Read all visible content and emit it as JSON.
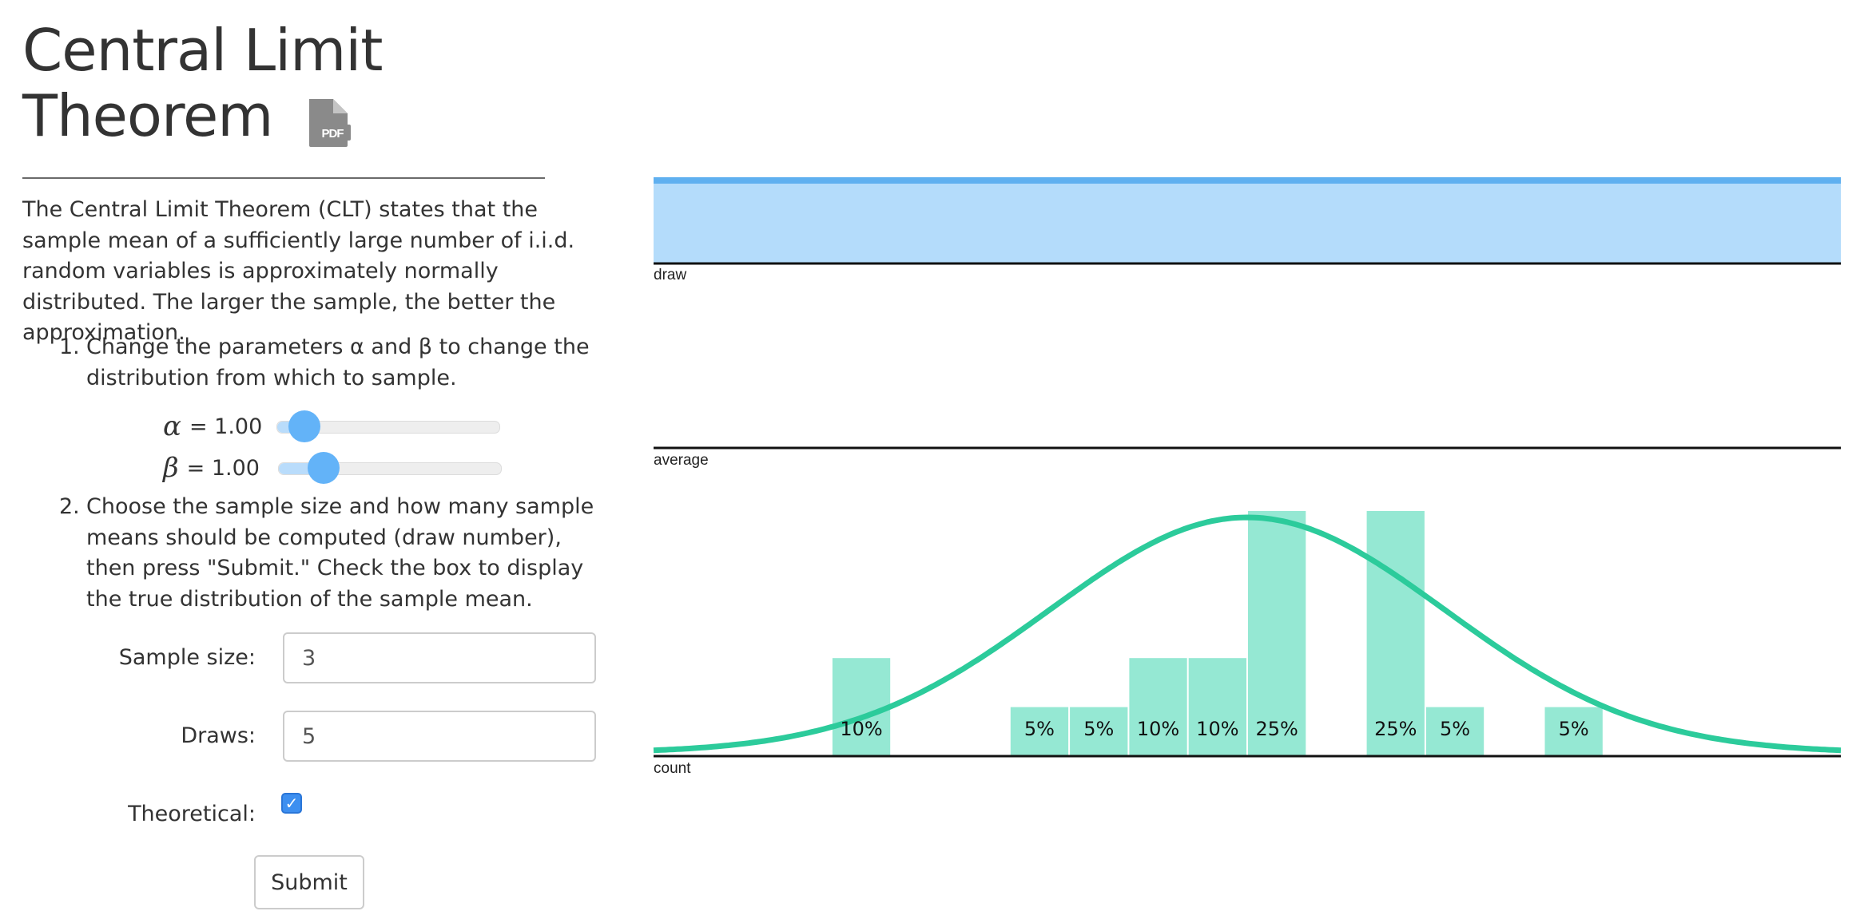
{
  "title_line1": "Central Limit",
  "title_line2": "Theorem",
  "pdf_icon": "pdf-file-icon",
  "intro": "The Central Limit Theorem (CLT) states that the sample mean of a sufficiently large number of i.i.d. random variables is approximately normally distributed. The larger the sample, the better the approximation.",
  "steps": [
    {
      "num": "1.",
      "text": "Change the parameters α and β to change the distribution from which to sample."
    },
    {
      "num": "2.",
      "text": "Choose the sample size and how many sample means should be computed (draw number), then press \"Submit.\" Check the box to display the true distribution of the sample mean."
    }
  ],
  "params": {
    "alpha": {
      "symbol": "α",
      "text": "= 1.00",
      "value": 1.0,
      "fraction": 0.07
    },
    "beta": {
      "symbol": "β",
      "text": "= 1.00",
      "value": 1.0,
      "fraction": 0.15
    }
  },
  "form": {
    "sample_size_label": "Sample size:",
    "sample_size_value": "3",
    "draws_label": "Draws:",
    "draws_value": "5",
    "theoretical_label": "Theoretical:",
    "theoretical_checked": true,
    "submit_label": "Submit"
  },
  "colors": {
    "draw_fill": "#b4dcfb",
    "draw_line": "#5fb0f0",
    "bar_fill": "#95e8d3",
    "curve": "#2ccb9b",
    "axis": "#111111"
  },
  "chart_data": {
    "type": "bar",
    "panels": [
      "draw",
      "average",
      "count"
    ],
    "bins": 20,
    "xlim": [
      0,
      1
    ],
    "count_percentages": [
      {
        "bin": 3,
        "label": "10%",
        "value": 10
      },
      {
        "bin": 6,
        "label": "5%",
        "value": 5
      },
      {
        "bin": 7,
        "label": "5%",
        "value": 5
      },
      {
        "bin": 8,
        "label": "10%",
        "value": 10
      },
      {
        "bin": 9,
        "label": "10%",
        "value": 10
      },
      {
        "bin": 10,
        "label": "25%",
        "value": 25
      },
      {
        "bin": 12,
        "label": "25%",
        "value": 25
      },
      {
        "bin": 13,
        "label": "5%",
        "value": 5
      },
      {
        "bin": 15,
        "label": "5%",
        "value": 5
      }
    ],
    "theoretical": {
      "mean": 0.5,
      "sd": 0.1667
    }
  }
}
